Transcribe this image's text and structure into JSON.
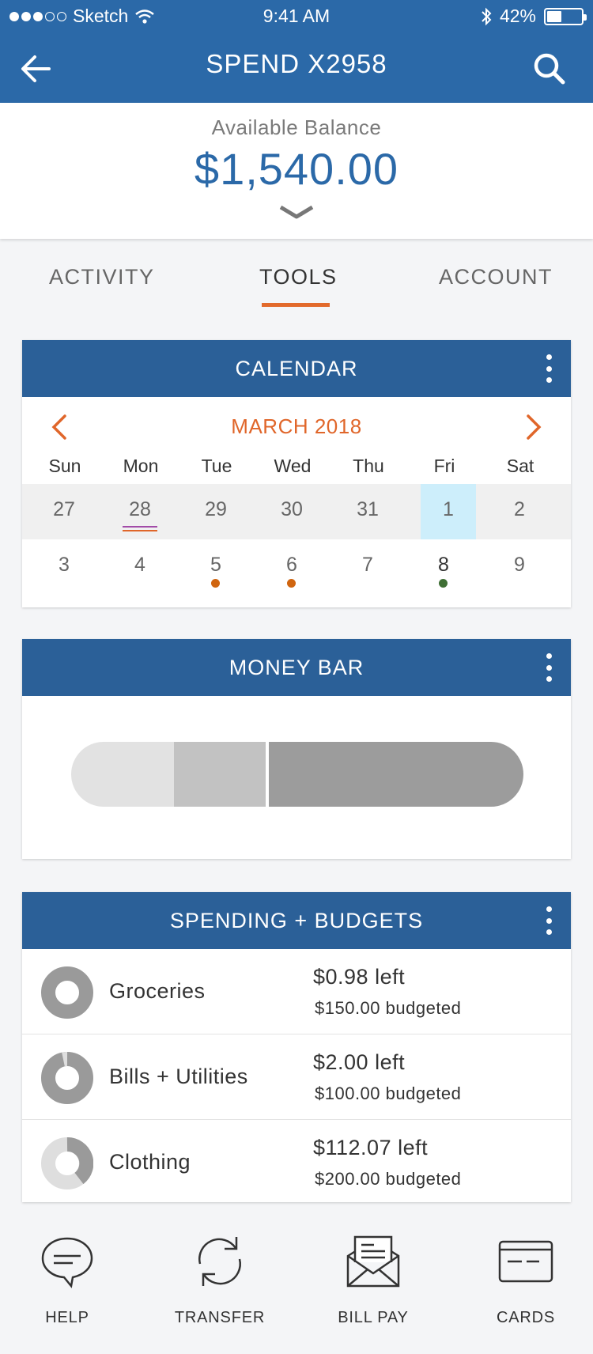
{
  "status_bar": {
    "carrier": "Sketch",
    "time": "9:41 AM",
    "battery": "42%"
  },
  "nav": {
    "title": "SPEND X2958",
    "back_icon": "arrow-left-icon",
    "search_icon": "search-icon"
  },
  "balance": {
    "label": "Available Balance",
    "amount": "$1,540.00"
  },
  "tabs": [
    {
      "label": "ACTIVITY",
      "active": false
    },
    {
      "label": "TOOLS",
      "active": true
    },
    {
      "label": "ACCOUNT",
      "active": false
    }
  ],
  "calendar": {
    "title": "CALENDAR",
    "month": "MARCH 2018",
    "weekdays": [
      "Sun",
      "Mon",
      "Tue",
      "Wed",
      "Thu",
      "Fri",
      "Sat"
    ],
    "week1": [
      "27",
      "28",
      "29",
      "30",
      "31",
      "1",
      "2"
    ],
    "week2": [
      "3",
      "4",
      "5",
      "6",
      "7",
      "8",
      "9"
    ]
  },
  "money_bar": {
    "title": "MONEY BAR"
  },
  "budgets": {
    "title": "SPENDING + BUDGETS",
    "items": [
      {
        "name": "Groceries",
        "left": "$0.98 left",
        "budgeted": "$150.00 budgeted"
      },
      {
        "name": "Bills + Utilities",
        "left": "$2.00 left",
        "budgeted": "$100.00 budgeted"
      },
      {
        "name": "Clothing",
        "left": "$112.07 left",
        "budgeted": "$200.00 budgeted"
      }
    ]
  },
  "bottom_nav": [
    {
      "label": "HELP",
      "icon": "chat-bubble-icon"
    },
    {
      "label": "TRANSFER",
      "icon": "transfer-arrows-icon"
    },
    {
      "label": "BILL PAY",
      "icon": "envelope-icon"
    },
    {
      "label": "CARDS",
      "icon": "credit-card-icon"
    }
  ],
  "colors": {
    "brand_blue": "#2b69a8",
    "accent_orange": "#e26a2c",
    "today_highlight": "#cdeefb",
    "event_orange": "#d0650f",
    "event_green": "#3f6f35"
  }
}
